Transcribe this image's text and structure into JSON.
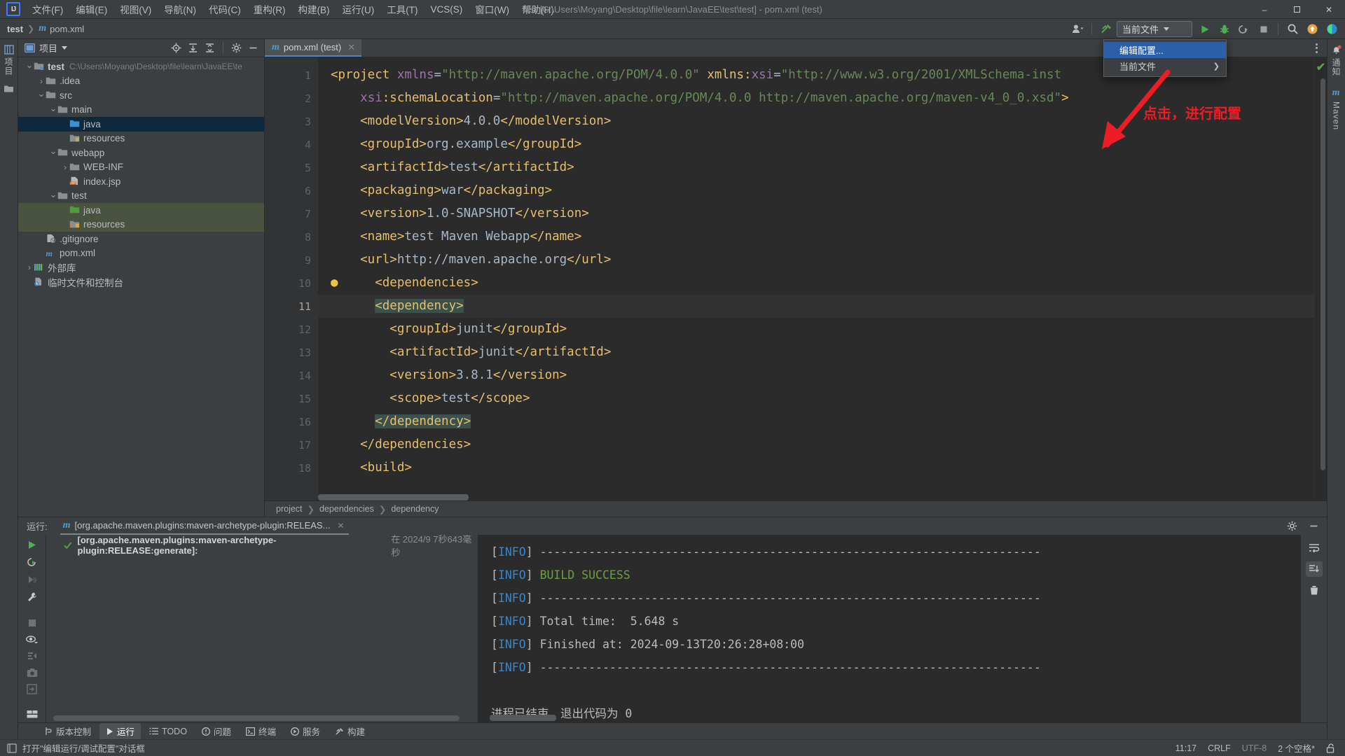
{
  "window": {
    "title": "test [C:\\Users\\Moyang\\Desktop\\file\\learn\\JavaEE\\test\\test] - pom.xml (test)",
    "app_logo": "IJ"
  },
  "menu": [
    {
      "label": "文件(F)",
      "name": "menu-file"
    },
    {
      "label": "编辑(E)",
      "name": "menu-edit"
    },
    {
      "label": "视图(V)",
      "name": "menu-view"
    },
    {
      "label": "导航(N)",
      "name": "menu-navigate"
    },
    {
      "label": "代码(C)",
      "name": "menu-code"
    },
    {
      "label": "重构(R)",
      "name": "menu-refactor"
    },
    {
      "label": "构建(B)",
      "name": "menu-build"
    },
    {
      "label": "运行(U)",
      "name": "menu-run"
    },
    {
      "label": "工具(T)",
      "name": "menu-tools"
    },
    {
      "label": "VCS(S)",
      "name": "menu-vcs"
    },
    {
      "label": "窗口(W)",
      "name": "menu-window"
    },
    {
      "label": "帮助(H)",
      "name": "menu-help"
    }
  ],
  "window_controls": {
    "minimize": "–",
    "maximize": "❐",
    "close": "✕"
  },
  "navbar": {
    "crumb_project": "test",
    "crumb_file": "pom.xml",
    "run_config": "当前文件",
    "icons": [
      "account-icon",
      "build-hammer-icon",
      "run-icon",
      "debug-icon",
      "run-coverage-icon",
      "stop-icon",
      "search-icon",
      "update-icon",
      "ide-assistant-icon"
    ]
  },
  "popup_menu": {
    "items": [
      {
        "label": "编辑配置...",
        "highlighted": true,
        "has_submenu": false
      },
      {
        "label": "当前文件",
        "highlighted": false,
        "has_submenu": true
      }
    ]
  },
  "annotation": {
    "text": "点击，进行配置",
    "color": "#ee1c25"
  },
  "left_rail": {
    "label": "项目"
  },
  "right_rail": {
    "items": [
      "通知",
      "Maven"
    ]
  },
  "project_panel": {
    "title": "项目",
    "tree": [
      {
        "depth": 0,
        "arrow": "v",
        "icon": "module-folder-icon",
        "name": "test",
        "bold": true,
        "path": "C:\\Users\\Moyang\\Desktop\\file\\learn\\JavaEE\\te",
        "state": "normal"
      },
      {
        "depth": 1,
        "arrow": ">",
        "icon": "folder-icon",
        "name": ".idea",
        "bold": false,
        "path": "",
        "state": "normal"
      },
      {
        "depth": 1,
        "arrow": "v",
        "icon": "folder-icon",
        "name": "src",
        "bold": false,
        "path": "",
        "state": "normal"
      },
      {
        "depth": 2,
        "arrow": "v",
        "icon": "folder-icon",
        "name": "main",
        "bold": false,
        "path": "",
        "state": "normal"
      },
      {
        "depth": 3,
        "arrow": "",
        "icon": "source-folder-icon",
        "name": "java",
        "bold": false,
        "path": "",
        "state": "selected"
      },
      {
        "depth": 3,
        "arrow": "",
        "icon": "resource-folder-icon",
        "name": "resources",
        "bold": false,
        "path": "",
        "state": "normal"
      },
      {
        "depth": 2,
        "arrow": "v",
        "icon": "folder-icon",
        "name": "webapp",
        "bold": false,
        "path": "",
        "state": "normal"
      },
      {
        "depth": 3,
        "arrow": ">",
        "icon": "folder-icon",
        "name": "WEB-INF",
        "bold": false,
        "path": "",
        "state": "normal"
      },
      {
        "depth": 3,
        "arrow": "",
        "icon": "jsp-file-icon",
        "name": "index.jsp",
        "bold": false,
        "path": "",
        "state": "normal"
      },
      {
        "depth": 2,
        "arrow": "v",
        "icon": "folder-icon",
        "name": "test",
        "bold": false,
        "path": "",
        "state": "normal"
      },
      {
        "depth": 3,
        "arrow": "",
        "icon": "test-source-folder-icon",
        "name": "java",
        "bold": false,
        "path": "",
        "state": "green"
      },
      {
        "depth": 3,
        "arrow": "",
        "icon": "test-resource-folder-icon",
        "name": "resources",
        "bold": false,
        "path": "",
        "state": "green"
      },
      {
        "depth": 1,
        "arrow": "",
        "icon": "gitignore-file-icon",
        "name": ".gitignore",
        "bold": false,
        "path": "",
        "state": "normal"
      },
      {
        "depth": 1,
        "arrow": "",
        "icon": "maven-pom-icon",
        "name": "pom.xml",
        "bold": false,
        "path": "",
        "state": "normal"
      },
      {
        "depth": 0,
        "arrow": ">",
        "icon": "library-icon",
        "name": "外部库",
        "bold": false,
        "path": "",
        "state": "normal"
      },
      {
        "depth": 0,
        "arrow": "",
        "icon": "scratches-icon",
        "name": "临时文件和控制台",
        "bold": false,
        "path": "",
        "state": "normal"
      }
    ],
    "header_icons": [
      "locate-icon",
      "expand-all-icon",
      "collapse-all-icon",
      "settings-gear-icon",
      "hide-icon"
    ]
  },
  "editor": {
    "tab": {
      "label": "pom.xml (test)",
      "close": "✕"
    },
    "lines": [
      {
        "n": 1,
        "fold": "minus",
        "bulb": false,
        "current": false,
        "tokens": [
          {
            "t": "<project ",
            "c": "tag"
          },
          {
            "t": "xmlns",
            "c": "attr"
          },
          {
            "t": "=",
            "c": "eq"
          },
          {
            "t": "\"http://maven.apache.org/POM/4.0.0\"",
            "c": "attrv"
          },
          {
            "t": " ",
            "c": "txt"
          },
          {
            "t": "xmlns:",
            "c": "tag"
          },
          {
            "t": "xsi",
            "c": "attr"
          },
          {
            "t": "=",
            "c": "eq"
          },
          {
            "t": "\"http://www.w3.org/2001/XMLSchema-inst",
            "c": "attrv"
          }
        ]
      },
      {
        "n": 2,
        "fold": "",
        "bulb": false,
        "current": false,
        "tokens": [
          {
            "t": "    ",
            "c": "txt"
          },
          {
            "t": "xsi",
            "c": "attr"
          },
          {
            "t": ":schemaLocation",
            "c": "tag"
          },
          {
            "t": "=",
            "c": "eq"
          },
          {
            "t": "\"http://maven.apache.org/POM/4.0.0 http://maven.apache.org/maven-v4_0_0.xsd\"",
            "c": "attrv"
          },
          {
            "t": ">",
            "c": "tag"
          }
        ]
      },
      {
        "n": 3,
        "fold": "",
        "bulb": false,
        "current": false,
        "tokens": [
          {
            "t": "    <modelVersion>",
            "c": "tag"
          },
          {
            "t": "4.0.0",
            "c": "txt"
          },
          {
            "t": "</modelVersion>",
            "c": "tag"
          }
        ]
      },
      {
        "n": 4,
        "fold": "",
        "bulb": false,
        "current": false,
        "tokens": [
          {
            "t": "    <groupId>",
            "c": "tag"
          },
          {
            "t": "org.example",
            "c": "txt"
          },
          {
            "t": "</groupId>",
            "c": "tag"
          }
        ]
      },
      {
        "n": 5,
        "fold": "",
        "bulb": false,
        "current": false,
        "tokens": [
          {
            "t": "    <artifactId>",
            "c": "tag"
          },
          {
            "t": "test",
            "c": "txt"
          },
          {
            "t": "</artifactId>",
            "c": "tag"
          }
        ]
      },
      {
        "n": 6,
        "fold": "",
        "bulb": false,
        "current": false,
        "tokens": [
          {
            "t": "    <packaging>",
            "c": "tag"
          },
          {
            "t": "war",
            "c": "txt"
          },
          {
            "t": "</packaging>",
            "c": "tag"
          }
        ]
      },
      {
        "n": 7,
        "fold": "",
        "bulb": false,
        "current": false,
        "tokens": [
          {
            "t": "    <version>",
            "c": "tag"
          },
          {
            "t": "1.0-SNAPSHOT",
            "c": "txt"
          },
          {
            "t": "</version>",
            "c": "tag"
          }
        ]
      },
      {
        "n": 8,
        "fold": "",
        "bulb": false,
        "current": false,
        "tokens": [
          {
            "t": "    <name>",
            "c": "tag"
          },
          {
            "t": "test Maven Webapp",
            "c": "txt"
          },
          {
            "t": "</name>",
            "c": "tag"
          }
        ]
      },
      {
        "n": 9,
        "fold": "",
        "bulb": false,
        "current": false,
        "tokens": [
          {
            "t": "    <url>",
            "c": "tag"
          },
          {
            "t": "http://maven.apache.org",
            "c": "txt"
          },
          {
            "t": "</url>",
            "c": "tag"
          }
        ]
      },
      {
        "n": 10,
        "fold": "minus",
        "bulb": true,
        "current": false,
        "tokens": [
          {
            "t": "    <dependencies>",
            "c": "tag"
          }
        ]
      },
      {
        "n": 11,
        "fold": "minus",
        "bulb": false,
        "current": true,
        "tokens": [
          {
            "t": "      ",
            "c": "txt"
          },
          {
            "t": "<dependency>",
            "c": "tag hl"
          }
        ]
      },
      {
        "n": 12,
        "fold": "",
        "bulb": false,
        "current": false,
        "tokens": [
          {
            "t": "        <groupId>",
            "c": "tag"
          },
          {
            "t": "junit",
            "c": "txt"
          },
          {
            "t": "</groupId>",
            "c": "tag"
          }
        ]
      },
      {
        "n": 13,
        "fold": "",
        "bulb": false,
        "current": false,
        "tokens": [
          {
            "t": "        <artifactId>",
            "c": "tag"
          },
          {
            "t": "junit",
            "c": "txt"
          },
          {
            "t": "</artifactId>",
            "c": "tag"
          }
        ]
      },
      {
        "n": 14,
        "fold": "",
        "bulb": false,
        "current": false,
        "tokens": [
          {
            "t": "        <version>",
            "c": "tag"
          },
          {
            "t": "3.8.1",
            "c": "txt"
          },
          {
            "t": "</version>",
            "c": "tag"
          }
        ]
      },
      {
        "n": 15,
        "fold": "",
        "bulb": false,
        "current": false,
        "tokens": [
          {
            "t": "        <scope>",
            "c": "tag"
          },
          {
            "t": "test",
            "c": "txt"
          },
          {
            "t": "</scope>",
            "c": "tag"
          }
        ]
      },
      {
        "n": 16,
        "fold": "end",
        "bulb": false,
        "current": false,
        "tokens": [
          {
            "t": "      ",
            "c": "txt"
          },
          {
            "t": "</dependency>",
            "c": "tag hl"
          }
        ]
      },
      {
        "n": 17,
        "fold": "end",
        "bulb": false,
        "current": false,
        "tokens": [
          {
            "t": "    </dependencies>",
            "c": "tag"
          }
        ]
      },
      {
        "n": 18,
        "fold": "minus",
        "bulb": false,
        "current": false,
        "tokens": [
          {
            "t": "    <build>",
            "c": "tag"
          }
        ]
      }
    ],
    "breadcrumbs": [
      "project",
      "dependencies",
      "dependency"
    ],
    "inspection_status": "ok"
  },
  "run_panel": {
    "label": "运行:",
    "tab_title": "[org.apache.maven.plugins:maven-archetype-plugin:RELEAS...",
    "tree_row": {
      "title": "[org.apache.maven.plugins:maven-archetype-plugin:RELEASE:generate]:",
      "meta": "在 2024/9 7秒643毫秒"
    },
    "header_icons": [
      "settings-gear-icon",
      "hide-panel-icon"
    ],
    "rail_icons": [
      "rerun-icon",
      "rerun-failed-icon",
      "skip-icon",
      "wrench-icon",
      "stop-icon",
      "eye-filter-icon",
      "export-icon",
      "camera-icon",
      "import-icon",
      "layout-icon",
      "expand-more-icon"
    ],
    "console_rail_icons": [
      "soft-wrap-icon",
      "scroll-to-end-icon",
      "trash-icon"
    ],
    "console": [
      {
        "segments": [
          {
            "t": "[",
            "c": "c-br"
          },
          {
            "t": "INFO",
            "c": "c-info"
          },
          {
            "t": "] ",
            "c": "c-br"
          },
          {
            "t": "------------------------------------------------------------------------",
            "c": "c-dash"
          }
        ]
      },
      {
        "segments": [
          {
            "t": "[",
            "c": "c-br"
          },
          {
            "t": "INFO",
            "c": "c-info"
          },
          {
            "t": "] ",
            "c": "c-br"
          },
          {
            "t": "BUILD SUCCESS",
            "c": "c-green"
          }
        ]
      },
      {
        "segments": [
          {
            "t": "[",
            "c": "c-br"
          },
          {
            "t": "INFO",
            "c": "c-info"
          },
          {
            "t": "] ",
            "c": "c-br"
          },
          {
            "t": "------------------------------------------------------------------------",
            "c": "c-dash"
          }
        ]
      },
      {
        "segments": [
          {
            "t": "[",
            "c": "c-br"
          },
          {
            "t": "INFO",
            "c": "c-info"
          },
          {
            "t": "] ",
            "c": "c-br"
          },
          {
            "t": "Total time:  5.648 s",
            "c": "c-br"
          }
        ]
      },
      {
        "segments": [
          {
            "t": "[",
            "c": "c-br"
          },
          {
            "t": "INFO",
            "c": "c-info"
          },
          {
            "t": "] ",
            "c": "c-br"
          },
          {
            "t": "Finished at: 2024-09-13T20:26:28+08:00",
            "c": "c-br"
          }
        ]
      },
      {
        "segments": [
          {
            "t": "[",
            "c": "c-br"
          },
          {
            "t": "INFO",
            "c": "c-info"
          },
          {
            "t": "] ",
            "c": "c-br"
          },
          {
            "t": "------------------------------------------------------------------------",
            "c": "c-dash"
          }
        ]
      },
      {
        "segments": [
          {
            "t": "",
            "c": "c-br"
          }
        ]
      },
      {
        "segments": [
          {
            "t": "进程已结束，退出代码为 0",
            "c": "c-br"
          }
        ]
      }
    ]
  },
  "tool_windows": [
    {
      "label": "版本控制",
      "icon": "vcs-icon",
      "active": false
    },
    {
      "label": "运行",
      "icon": "run-icon",
      "active": true
    },
    {
      "label": "TODO",
      "icon": "todo-icon",
      "active": false
    },
    {
      "label": "问题",
      "icon": "problems-icon",
      "active": false
    },
    {
      "label": "终端",
      "icon": "terminal-icon",
      "active": false
    },
    {
      "label": "服务",
      "icon": "services-icon",
      "active": false
    },
    {
      "label": "构建",
      "icon": "build-icon",
      "active": false
    }
  ],
  "statusbar": {
    "hint": "打开\"编辑运行/调试配置\"对话框",
    "caret": "11:17",
    "line_sep": "CRLF",
    "encoding": "UTF-8",
    "indent": "2 个空格*",
    "lock": "unlocked-icon"
  }
}
